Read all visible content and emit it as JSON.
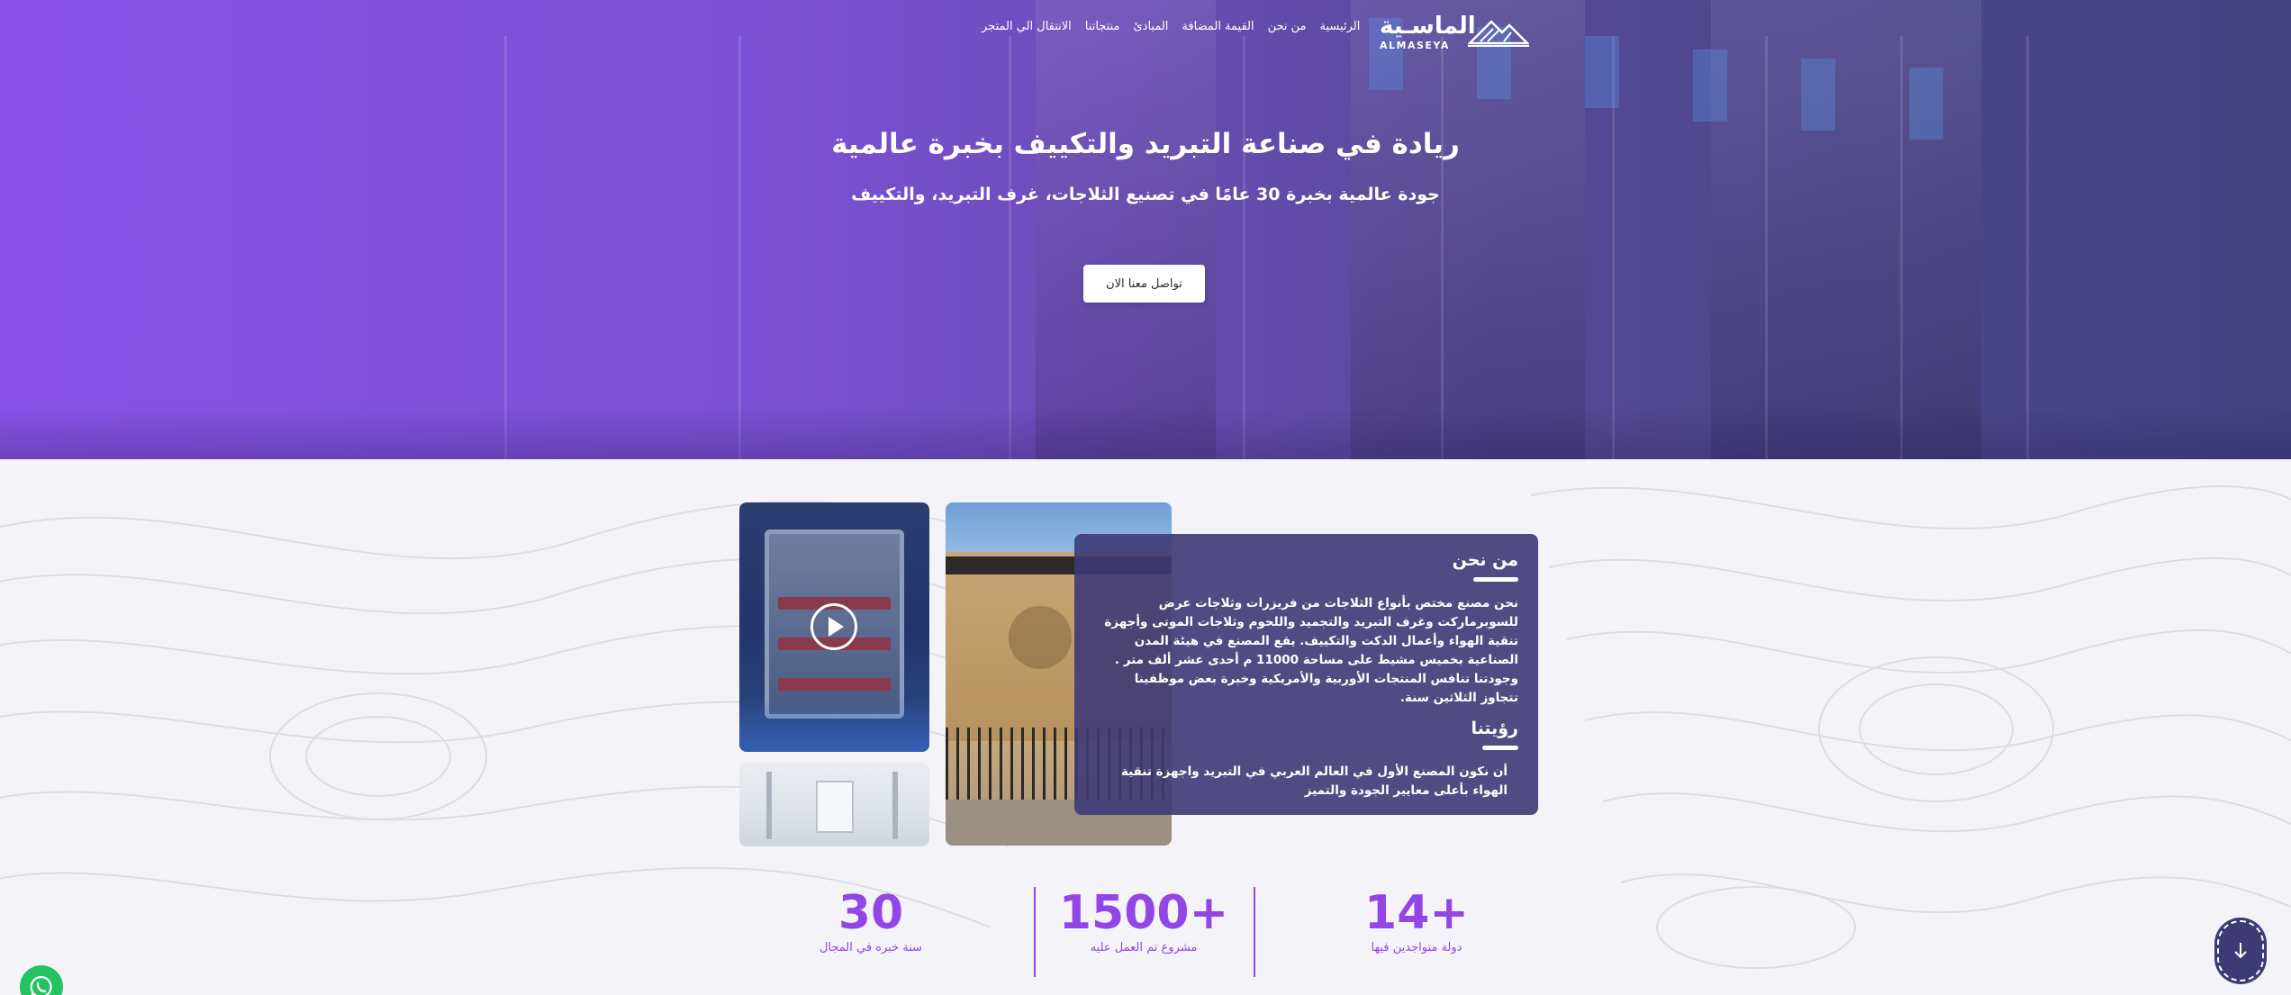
{
  "brand": {
    "name_ar": "الماسـية",
    "name_en": "ALMASEYA"
  },
  "nav": {
    "items": [
      "الرئيسية",
      "من نحن",
      "القيمة المضافة",
      "المبادئ",
      "منتجاتنا",
      "الانتقال الي المتجر"
    ]
  },
  "hero": {
    "title": "ريادة في صناعة التبريد والتكييف بخبرة عالمية",
    "subtitle": "جودة عالمية بخبرة 30 عامًا في تصنيع الثلاجات، غرف التبريد، والتكييف",
    "cta_label": "تواصل معنا الان"
  },
  "about": {
    "heading": "من نحن",
    "body": "نحن مصنع مختص بأنواع الثلاجات من فريزرات وثلاجات عرض للسوبرماركت وغرف التبريد والتجميد واللحوم وثلاجات الموتى وأجهزة تنقية الهواء وأعمال الدكت والتكييف. يقع المصنع في هيئة المدن الصناعية بخميس مشيط على مساحة 11000 م أحدى عشر ألف متر . وجودتنا تنافس المنتجات الأوربية والأمريكية وخبرة بعض موظفينا تتجاوز الثلاثين سنة.",
    "vision_heading": "رؤيتنا",
    "vision_body": "أن نكون المصنع الأول في العالم العربي في التبريد واجهزة تنقية الهواء بأعلى معايير الجودة والتميز"
  },
  "stats": [
    {
      "value": "14+",
      "label": "دولة متواجدين فيها"
    },
    {
      "value": "1500+",
      "label": "مشروع تم العمل عليه"
    },
    {
      "value": "30",
      "label": "سنة خبره في المجال"
    }
  ],
  "colors": {
    "accent": "#9346e6",
    "card": "#3e3a76",
    "whatsapp": "#25c260"
  },
  "icons": {
    "play": "play-icon",
    "scroll": "arrow-down-icon",
    "whatsapp": "whatsapp-icon"
  }
}
